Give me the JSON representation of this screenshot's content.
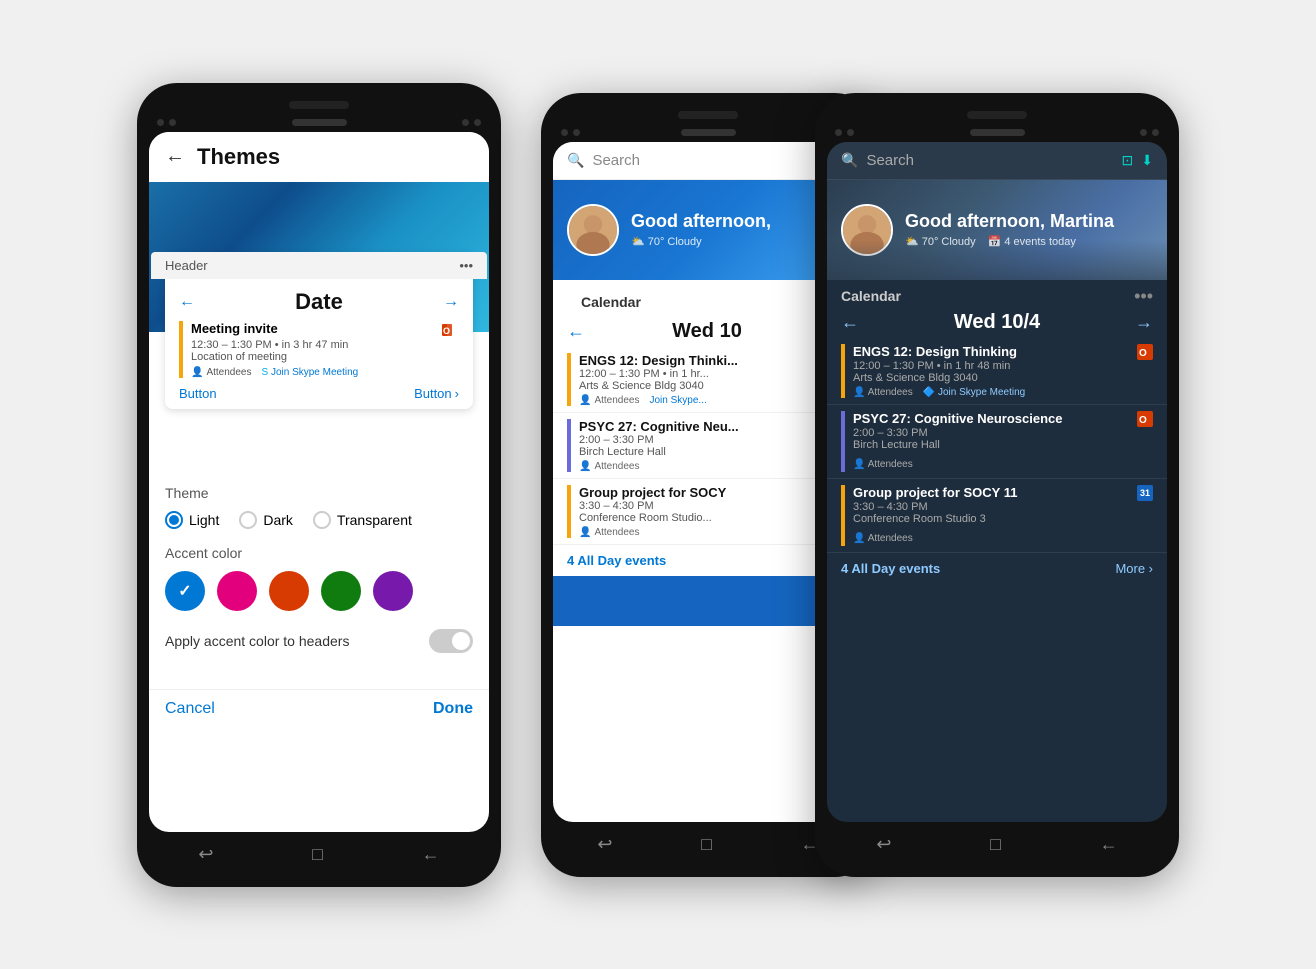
{
  "phone1": {
    "title": "Themes",
    "back_icon": "←",
    "preview": {
      "header_label": "Header",
      "more_icon": "•••",
      "date_label": "Date",
      "left_arrow": "←",
      "right_arrow": "→",
      "meeting": {
        "title": "Meeting invite",
        "time": "12:30 – 1:30 PM • in 3 hr 47 min",
        "location": "Location of meeting",
        "attendees": "Attendees",
        "skype": "Join Skype Meeting"
      },
      "button_left": "Button",
      "button_right": "Button",
      "button_right_arrow": "›"
    },
    "theme": {
      "label": "Theme",
      "options": [
        "Light",
        "Dark",
        "Transparent"
      ],
      "selected": "Light"
    },
    "accent": {
      "label": "Accent color",
      "colors": [
        "#0078d4",
        "#e3007d",
        "#d83b01",
        "#107c10",
        "#7719aa"
      ],
      "selected": 0
    },
    "apply_headers": {
      "label": "Apply accent color to headers",
      "enabled": false
    },
    "cancel_label": "Cancel",
    "done_label": "Done",
    "nav_icons": [
      "↩",
      "□",
      "←"
    ]
  },
  "phone2": {
    "search_placeholder": "Search",
    "greeting": "Good afternoon,",
    "weather": "70° Cloudy",
    "calendar_label": "Calendar",
    "date_nav": {
      "left": "←",
      "title": "Wed 10",
      "right": "→"
    },
    "events": [
      {
        "title": "ENGS 12: Design Thinki...",
        "time": "12:00 – 1:30 PM • in 1 hr...",
        "location": "Arts & Science Bldg 3040",
        "attendees": "Attendees",
        "skype": "Join Skype...",
        "color": "orange"
      },
      {
        "title": "PSYC 27: Cognitive Neu...",
        "time": "2:00 – 3:30 PM",
        "location": "Birch Lecture Hall",
        "attendees": "Attendees",
        "color": "blue"
      },
      {
        "title": "Group project for SOCY",
        "time": "3:30 – 4:30 PM",
        "location": "Conference Room Studio...",
        "attendees": "Attendees",
        "color": "orange"
      }
    ],
    "all_day": "4 All Day events",
    "bottom_bar_color": "#1565c0",
    "nav_icons": [
      "↩",
      "□",
      "←"
    ]
  },
  "phone3": {
    "search_placeholder": "Search",
    "search_icons": [
      "⊡",
      "⬇"
    ],
    "greeting": "Good afternoon, Martina",
    "weather": "70° Cloudy",
    "events_today": "4 events today",
    "calendar_label": "Calendar",
    "date_nav": {
      "left": "←",
      "title": "Wed 10/4",
      "right": "→"
    },
    "events": [
      {
        "title": "ENGS 12: Design Thinking",
        "time": "12:00 – 1:30 PM • in 1 hr 48 min",
        "location": "Arts & Science Bldg 3040",
        "attendees": "Attendees",
        "skype": "Join Skype Meeting",
        "color": "orange",
        "has_office": true
      },
      {
        "title": "PSYC 27: Cognitive Neuroscience",
        "time": "2:00 – 3:30 PM",
        "location": "Birch Lecture Hall",
        "attendees": "Attendees",
        "color": "blue",
        "has_office": true
      },
      {
        "title": "Group project for SOCY 11",
        "time": "3:30 – 4:30 PM",
        "location": "Conference Room Studio 3",
        "attendees": "Attendees",
        "color": "orange",
        "has_calendar": true
      }
    ],
    "all_day": "4 All Day events",
    "more": "More ›",
    "nav_icons": [
      "↩",
      "□",
      "←"
    ]
  }
}
